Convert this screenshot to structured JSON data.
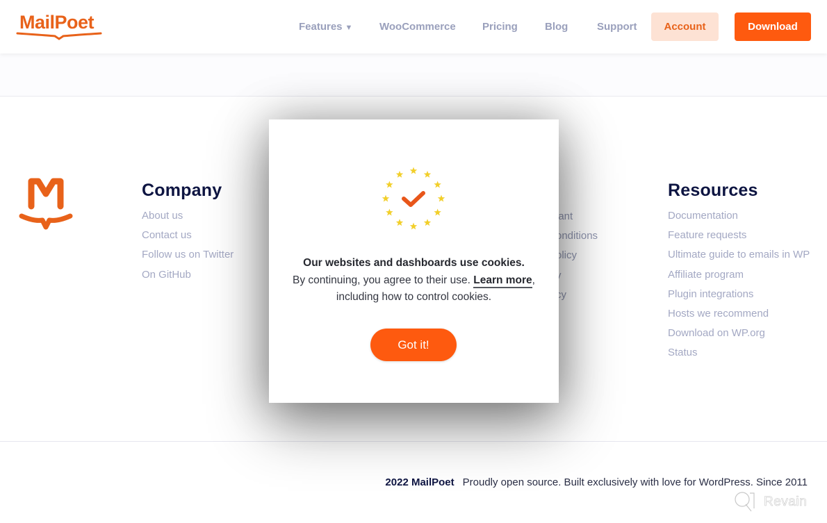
{
  "header": {
    "logo_text": "MailPoet",
    "nav": [
      {
        "label": "Features",
        "has_dropdown": true,
        "caret": "▼"
      },
      {
        "label": "WooCommerce"
      },
      {
        "label": "Pricing"
      },
      {
        "label": "Blog"
      },
      {
        "label": "Support"
      }
    ],
    "account_label": "Account",
    "download_label": "Download"
  },
  "footer": {
    "company": {
      "title": "Company",
      "links": [
        "About us",
        "Contact us",
        "Follow us on Twitter",
        "On GitHub"
      ]
    },
    "legal_partial": {
      "links": [
        "iant",
        "onditions",
        "olicy",
        "y",
        "cy"
      ]
    },
    "resources": {
      "title": "Resources",
      "links": [
        "Documentation",
        "Feature requests",
        "Ultimate guide to emails in WP",
        "Affiliate program",
        "Plugin integrations",
        "Hosts we recommend",
        "Download on WP.org",
        "Status"
      ]
    },
    "copyright_brand": "2022 MailPoet",
    "tagline": "Proudly open source. Built exclusively with love for WordPress. Since 2011"
  },
  "cookie_modal": {
    "heading": "Our websites and dashboards use cookies.",
    "body_before": "By continuing, you agree to their use. ",
    "link_label": "Learn more",
    "body_after": ", including how to control cookies.",
    "button_label": "Got it!",
    "icon": "eu-stars-checkmark-icon"
  },
  "watermark": {
    "label": "Revain"
  },
  "colors": {
    "brand_orange": "#fe5a0f",
    "logo_orange": "#e8621a",
    "navy": "#0e1542",
    "link_gray": "#a3a8c3",
    "account_bg": "#fde2d4",
    "star_yellow": "#f2cf2a"
  }
}
